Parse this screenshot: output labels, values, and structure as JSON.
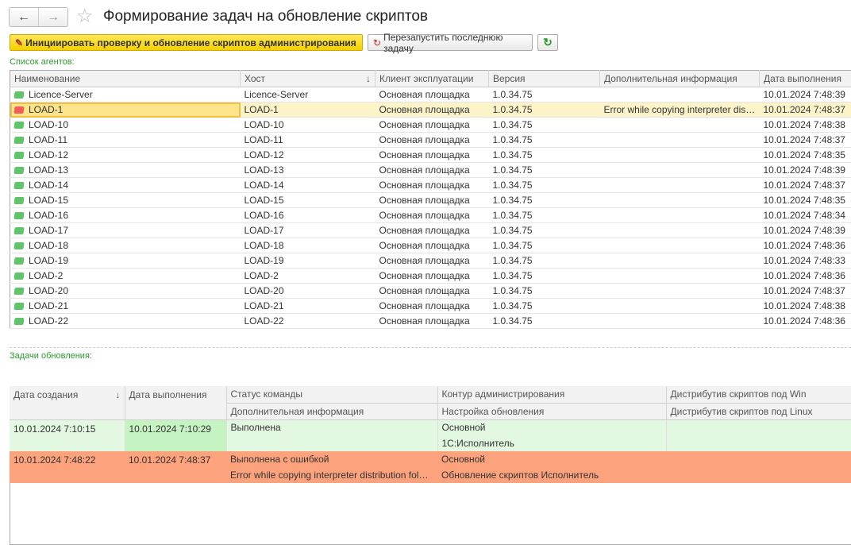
{
  "header": {
    "title": "Формирование задач на обновление скриптов",
    "back_icon": "arrow-left",
    "forward_icon": "arrow-right",
    "favorite_icon": "star"
  },
  "toolbar": {
    "initiate_label": "Инициировать проверку и обновление скриптов администрирования",
    "restart_label": "Перезапустить последнюю задачу",
    "refresh_icon": "refresh"
  },
  "agents": {
    "label": "Список агентов:",
    "columns": [
      "Наименование",
      "Хост",
      "Клиент эксплуатации",
      "Версия",
      "Дополнительная информация",
      "Дата выполнения"
    ],
    "sort_indicator": "↓",
    "rows": [
      {
        "name": "Licence-Server",
        "host": "Licence-Server",
        "client": "Основная площадка",
        "version": "1.0.34.75",
        "info": "",
        "date": "10.01.2024 7:48:39",
        "status": "ok"
      },
      {
        "name": "LOAD-1",
        "host": "LOAD-1",
        "client": "Основная площадка",
        "version": "1.0.34.75",
        "info": "Error while copying interpreter distribution folder: {}",
        "date": "10.01.2024 7:48:37",
        "status": "error"
      },
      {
        "name": "LOAD-10",
        "host": "LOAD-10",
        "client": "Основная площадка",
        "version": "1.0.34.75",
        "info": "",
        "date": "10.01.2024 7:48:38",
        "status": "ok"
      },
      {
        "name": "LOAD-11",
        "host": "LOAD-11",
        "client": "Основная площадка",
        "version": "1.0.34.75",
        "info": "",
        "date": "10.01.2024 7:48:37",
        "status": "ok"
      },
      {
        "name": "LOAD-12",
        "host": "LOAD-12",
        "client": "Основная площадка",
        "version": "1.0.34.75",
        "info": "",
        "date": "10.01.2024 7:48:35",
        "status": "ok"
      },
      {
        "name": "LOAD-13",
        "host": "LOAD-13",
        "client": "Основная площадка",
        "version": "1.0.34.75",
        "info": "",
        "date": "10.01.2024 7:48:39",
        "status": "ok"
      },
      {
        "name": "LOAD-14",
        "host": "LOAD-14",
        "client": "Основная площадка",
        "version": "1.0.34.75",
        "info": "",
        "date": "10.01.2024 7:48:37",
        "status": "ok"
      },
      {
        "name": "LOAD-15",
        "host": "LOAD-15",
        "client": "Основная площадка",
        "version": "1.0.34.75",
        "info": "",
        "date": "10.01.2024 7:48:35",
        "status": "ok"
      },
      {
        "name": "LOAD-16",
        "host": "LOAD-16",
        "client": "Основная площадка",
        "version": "1.0.34.75",
        "info": "",
        "date": "10.01.2024 7:48:34",
        "status": "ok"
      },
      {
        "name": "LOAD-17",
        "host": "LOAD-17",
        "client": "Основная площадка",
        "version": "1.0.34.75",
        "info": "",
        "date": "10.01.2024 7:48:39",
        "status": "ok"
      },
      {
        "name": "LOAD-18",
        "host": "LOAD-18",
        "client": "Основная площадка",
        "version": "1.0.34.75",
        "info": "",
        "date": "10.01.2024 7:48:36",
        "status": "ok"
      },
      {
        "name": "LOAD-19",
        "host": "LOAD-19",
        "client": "Основная площадка",
        "version": "1.0.34.75",
        "info": "",
        "date": "10.01.2024 7:48:33",
        "status": "ok"
      },
      {
        "name": "LOAD-2",
        "host": "LOAD-2",
        "client": "Основная площадка",
        "version": "1.0.34.75",
        "info": "",
        "date": "10.01.2024 7:48:36",
        "status": "ok"
      },
      {
        "name": "LOAD-20",
        "host": "LOAD-20",
        "client": "Основная площадка",
        "version": "1.0.34.75",
        "info": "",
        "date": "10.01.2024 7:48:37",
        "status": "ok"
      },
      {
        "name": "LOAD-21",
        "host": "LOAD-21",
        "client": "Основная площадка",
        "version": "1.0.34.75",
        "info": "",
        "date": "10.01.2024 7:48:38",
        "status": "ok"
      },
      {
        "name": "LOAD-22",
        "host": "LOAD-22",
        "client": "Основная площадка",
        "version": "1.0.34.75",
        "info": "",
        "date": "10.01.2024 7:48:36",
        "status": "ok"
      }
    ]
  },
  "tasks": {
    "label": "Задачи обновления:",
    "columns": {
      "created": "Дата создания",
      "executed": "Дата выполнения",
      "status": "Статус команды",
      "info": "Дополнительная информация",
      "contour": "Контур администрирования",
      "setting": "Настройка обновления",
      "win": "Дистрибутив скриптов под Win",
      "linux": "Дистрибутив скриптов под Linux"
    },
    "rows": [
      {
        "created": "10.01.2024 7:10:15",
        "executed": "10.01.2024 7:10:29",
        "status": "Выполнена",
        "info": "",
        "contour": "Основной",
        "setting": "1С:Исполнитель",
        "win": "",
        "linux": "",
        "state": "success"
      },
      {
        "created": "10.01.2024 7:48:22",
        "executed": "10.01.2024 7:48:37",
        "status": "Выполнена с ошибкой",
        "info": "Error while copying interpreter distribution folder: {}",
        "contour": "Основной",
        "setting": "Обновление скриптов Исполнитель",
        "win": "",
        "linux": "",
        "state": "error"
      }
    ]
  },
  "colors": {
    "ok": "#5fc46a",
    "error": "#f25c5c",
    "success_row": "#e2f8e0",
    "error_row": "#fca27c",
    "selected_row": "#fdf3c8",
    "accent_label": "#2a9a2a"
  }
}
